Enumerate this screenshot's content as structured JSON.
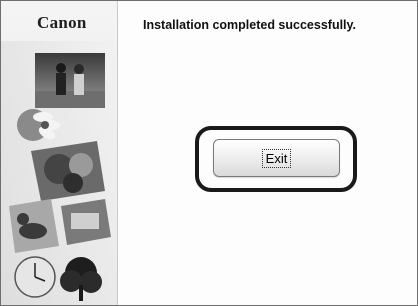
{
  "window": {
    "logo": "Canon",
    "title": "Installation completed successfully."
  },
  "actions": {
    "exit_label": "Exit"
  }
}
